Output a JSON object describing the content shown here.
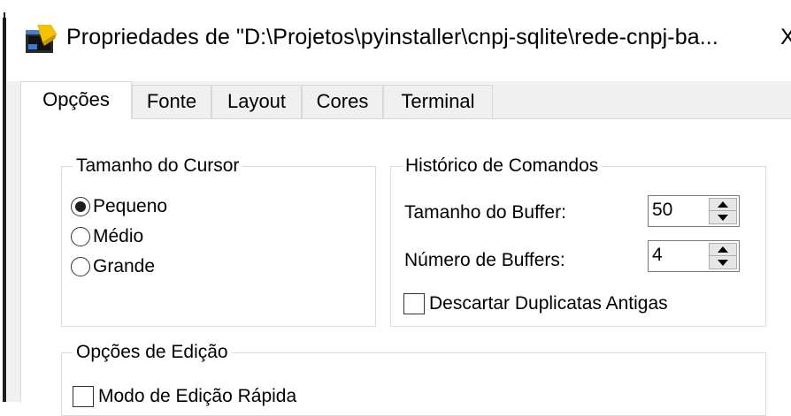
{
  "window": {
    "title": "Propriedades de \"D:\\Projetos\\pyinstaller\\cnpj-sqlite\\rede-cnpj-ba...",
    "close_glyph": "X",
    "icon": "console-app-icon"
  },
  "tabs": [
    {
      "label": "Opções",
      "active": true
    },
    {
      "label": "Fonte",
      "active": false
    },
    {
      "label": "Layout",
      "active": false
    },
    {
      "label": "Cores",
      "active": false
    },
    {
      "label": "Terminal",
      "active": false
    }
  ],
  "cursor_size": {
    "title": "Tamanho do Cursor",
    "options": [
      {
        "label": "Pequeno",
        "selected": true
      },
      {
        "label": "Médio",
        "selected": false
      },
      {
        "label": "Grande",
        "selected": false
      }
    ]
  },
  "command_history": {
    "title": "Histórico de Comandos",
    "buffer_size_label": "Tamanho do Buffer:",
    "buffer_size_value": "50",
    "buffer_count_label": "Número de Buffers:",
    "buffer_count_value": "4",
    "discard_duplicates_label": "Descartar Duplicatas Antigas",
    "discard_duplicates_checked": false
  },
  "edit_options": {
    "title": "Opções de Edição",
    "quick_edit_label": "Modo de Edição Rápida",
    "quick_edit_checked": false
  },
  "colors": {
    "dialog_bg": "#f0f0f0",
    "panel_bg": "#ffffff",
    "border": "#d9d9d9"
  }
}
